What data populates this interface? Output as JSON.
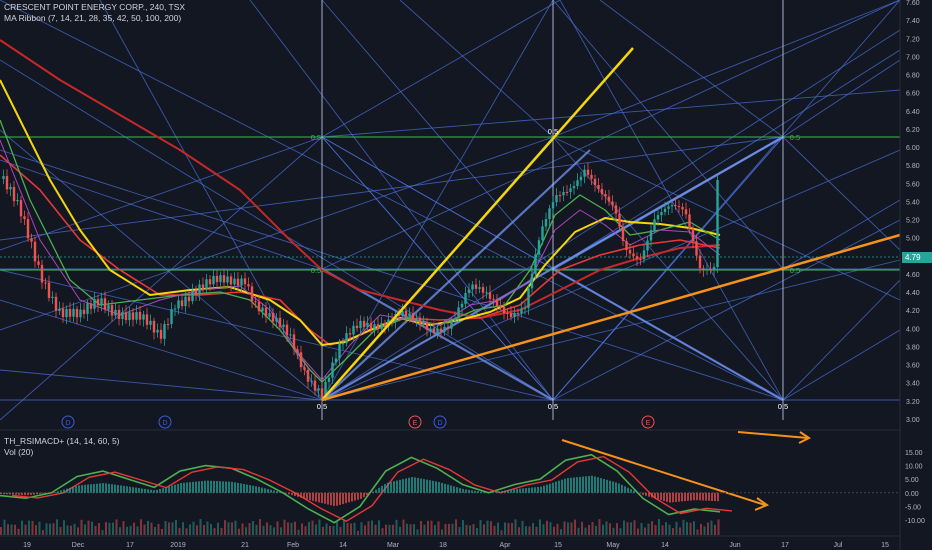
{
  "symbol": {
    "title": "CRESCENT POINT ENERGY CORP., 240, TSX",
    "indicator": "MA Ribbon (7, 14, 21, 28, 35, 42, 50, 100, 200)"
  },
  "oscillator": {
    "title": "TH_RSIMACD+ (14, 14, 60, 5)",
    "volume": "Vol (20)"
  },
  "price_axis_labels": [
    "7.60",
    "7.40",
    "7.20",
    "7.00",
    "6.80",
    "6.60",
    "6.40",
    "6.20",
    "6.00",
    "5.80",
    "5.60",
    "5.40",
    "5.20",
    "5.00",
    "4.80",
    "4.60",
    "4.40",
    "4.20",
    "4.00",
    "3.80",
    "3.60",
    "3.40",
    "3.20",
    "3.00"
  ],
  "osc_axis_labels": [
    "15.00",
    "10.00",
    "5.00",
    "0.00",
    "-5.00",
    "-10.00"
  ],
  "time_axis_labels": [
    "19",
    "Dec",
    "17",
    "2019",
    "21",
    "Feb",
    "14",
    "Mar",
    "18",
    "Apr",
    "15",
    "May",
    "14",
    "Jun",
    "17",
    "Jul",
    "15"
  ],
  "last_price": "4.79",
  "last_price_color": "#26a69a",
  "gann_labels": [
    "0.5",
    "0.5",
    "0.5",
    "0.5",
    "0.5",
    "0.5",
    "0.5",
    "0.5"
  ],
  "event_markers": [
    "D",
    "D",
    "E",
    "D",
    "E"
  ],
  "colors": {
    "background": "#131722",
    "grid_blue": "#4a6fd6",
    "yellow": "#f5d60a",
    "orange": "#f5921b",
    "green_level": "#3fb950",
    "red_ma": "#c62828",
    "up": "#26a69a",
    "down": "#ef5350"
  },
  "chart_data": {
    "type": "line",
    "title": "CRESCENT POINT ENERGY CORP., 240, TSX",
    "price_range": [
      3.0,
      7.6
    ],
    "osc_range": [
      -12,
      16
    ],
    "x": [
      "19",
      "Dec",
      "17",
      "2019",
      "21",
      "Feb",
      "14",
      "Mar",
      "18",
      "Apr",
      "15",
      "May",
      "14",
      "Jun",
      "17",
      "Jul",
      "15"
    ],
    "series": [
      {
        "name": "price",
        "values": [
          5.6,
          5.2,
          4.5,
          4.35,
          4.1,
          4.4,
          4.45,
          4.7,
          4.3,
          3.6,
          3.3,
          4.0,
          4.35,
          4.15,
          4.1,
          4.15,
          4.55,
          4.4,
          4.2,
          5.3,
          5.6,
          5.9,
          5.5,
          5.0,
          4.8,
          5.3,
          5.4,
          4.8,
          4.79
        ]
      }
    ],
    "oscillator_series": [
      {
        "values": [
          -1,
          -2,
          0,
          6,
          8,
          5,
          2,
          8,
          10,
          9,
          5,
          0,
          -6,
          -11,
          -5,
          8,
          13,
          9,
          3,
          0,
          3,
          5,
          12,
          14,
          8,
          -2,
          -8,
          -6,
          -7
        ]
      }
    ]
  }
}
